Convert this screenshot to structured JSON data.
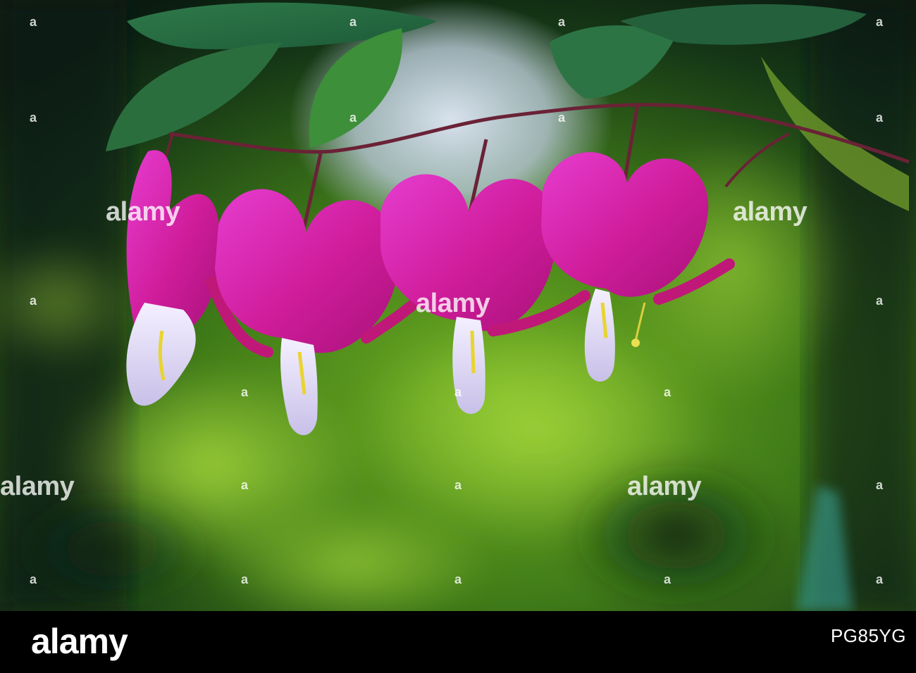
{
  "watermark": {
    "brand": "alamy",
    "glyph": "a"
  },
  "footer": {
    "brand": "alamy",
    "image_id": "PG85YG"
  },
  "colors": {
    "petal": "#d21ea0",
    "background_green": "#6aa82a",
    "footer": "#000000"
  }
}
